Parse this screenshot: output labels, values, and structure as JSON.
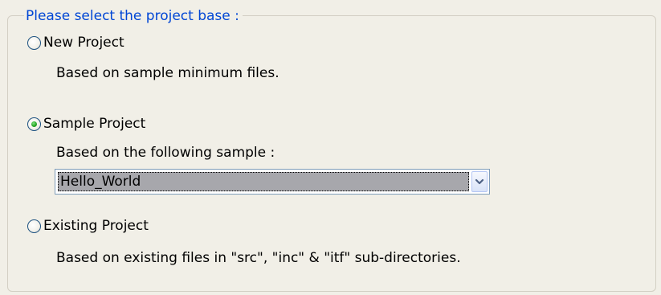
{
  "groupbox": {
    "title": "Please select the project base :"
  },
  "options": [
    {
      "label": "New Project",
      "description": "Based on sample minimum files.",
      "selected": false
    },
    {
      "label": "Sample Project",
      "description": "Based on the following sample :",
      "selected": true
    },
    {
      "label": "Existing Project",
      "description": "Based on existing files in \"src\", \"inc\" & \"itf\" sub-directories.",
      "selected": false
    }
  ],
  "sample_select": {
    "value": "Hello_World",
    "icon": "chevron-down-icon"
  },
  "colors": {
    "legend": "#0046d5",
    "background": "#f1efe7",
    "selected_text_bg": "#a7a7ac",
    "radio_dot": "#27a827"
  }
}
